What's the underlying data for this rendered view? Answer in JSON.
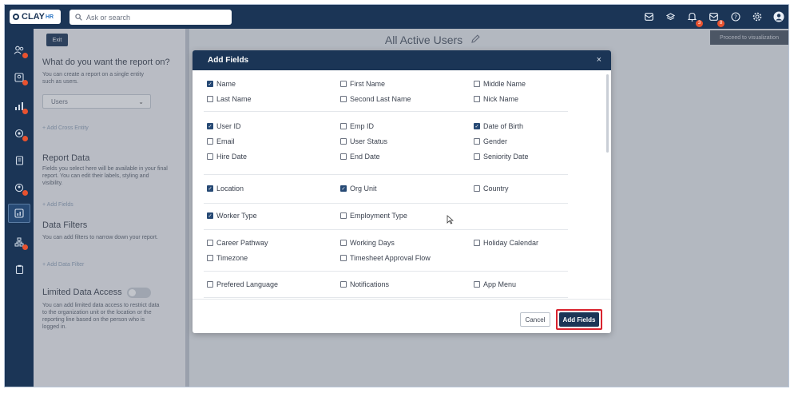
{
  "topbar": {
    "logo_text": "CLAY",
    "logo_suffix": "HR",
    "search_placeholder": "Ask or search",
    "icons": [
      "mail-icon",
      "layers-icon",
      "bell-icon",
      "inbox-icon",
      "help-icon",
      "settings-icon",
      "avatar"
    ],
    "notification_badge": "3",
    "inbox_badge": "8"
  },
  "left_panel": {
    "exit_label": "Exit",
    "report_on_heading": "What do you want the report on?",
    "report_on_desc": "You can create a report on a single entity such as users.",
    "entity_selected": "Users",
    "add_cross_entity": "+ Add Cross Entity",
    "report_data_heading": "Report Data",
    "report_data_desc": "Fields you select here will be available in your final report. You can edit their labels, styling and visibility.",
    "add_fields_link": "+ Add Fields",
    "data_filters_heading": "Data Filters",
    "data_filters_desc": "You can add filters to narrow down your report.",
    "add_data_filter": "+ Add Data Filter",
    "limited_access_heading": "Limited Data Access",
    "limited_access_desc": "You can add limited data access to restrict data to the organization unit or the location or the reporting line based on the person who is logged in."
  },
  "main": {
    "title": "All Active Users",
    "proceed_label": "Proceed to visualization"
  },
  "modal": {
    "title": "Add Fields",
    "close": "×",
    "cancel_label": "Cancel",
    "add_label": "Add Fields",
    "fields": {
      "name": {
        "label": "Name",
        "checked": true
      },
      "first_name": {
        "label": "First Name",
        "checked": false
      },
      "middle_name": {
        "label": "Middle Name",
        "checked": false
      },
      "last_name": {
        "label": "Last Name",
        "checked": false
      },
      "second_last_name": {
        "label": "Second Last Name",
        "checked": false
      },
      "nick_name": {
        "label": "Nick Name",
        "checked": false
      },
      "user_id": {
        "label": "User ID",
        "checked": true
      },
      "emp_id": {
        "label": "Emp ID",
        "checked": false
      },
      "date_of_birth": {
        "label": "Date of Birth",
        "checked": true
      },
      "email": {
        "label": "Email",
        "checked": false
      },
      "user_status": {
        "label": "User Status",
        "checked": false
      },
      "gender": {
        "label": "Gender",
        "checked": false
      },
      "hire_date": {
        "label": "Hire Date",
        "checked": false
      },
      "end_date": {
        "label": "End Date",
        "checked": false
      },
      "seniority_date": {
        "label": "Seniority Date",
        "checked": false
      },
      "location": {
        "label": "Location",
        "checked": true
      },
      "org_unit": {
        "label": "Org Unit",
        "checked": true
      },
      "country": {
        "label": "Country",
        "checked": false
      },
      "worker_type": {
        "label": "Worker Type",
        "checked": true
      },
      "employment_type": {
        "label": "Employment Type",
        "checked": false
      },
      "career_pathway": {
        "label": "Career Pathway",
        "checked": false
      },
      "working_days": {
        "label": "Working Days",
        "checked": false
      },
      "holiday_calendar": {
        "label": "Holiday Calendar",
        "checked": false
      },
      "timezone": {
        "label": "Timezone",
        "checked": false
      },
      "timesheet_approval_flow": {
        "label": "Timesheet Approval Flow",
        "checked": false
      },
      "prefered_language": {
        "label": "Prefered Language",
        "checked": false
      },
      "notifications": {
        "label": "Notifications",
        "checked": false
      },
      "app_menu": {
        "label": "App Menu",
        "checked": false
      }
    }
  },
  "colors": {
    "navy": "#1b3556",
    "accent_red": "#d9232e",
    "badge": "#e8522f"
  }
}
